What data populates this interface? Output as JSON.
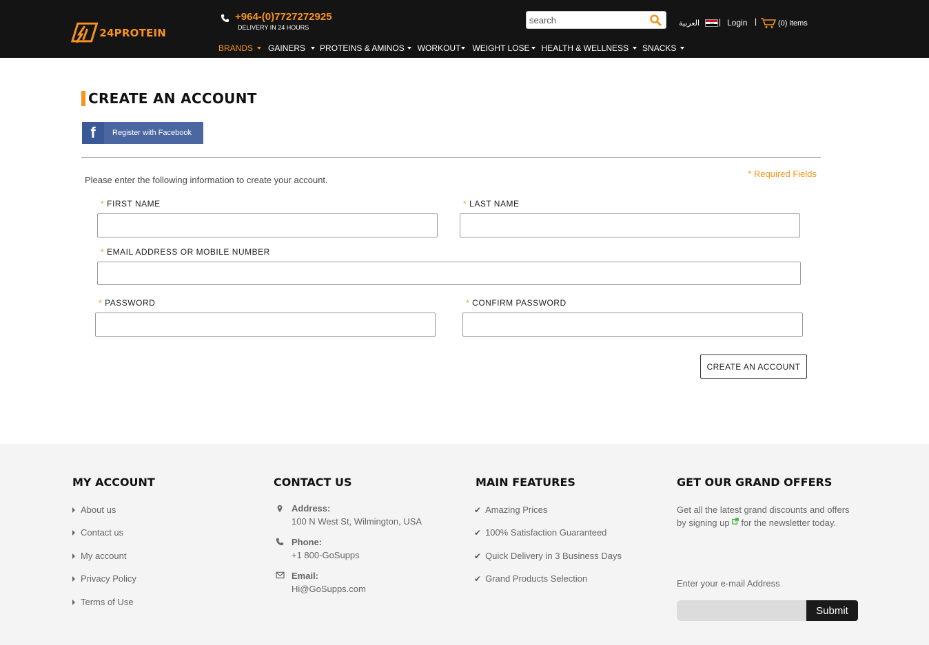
{
  "header": {
    "logo_text": "24PROTEIN",
    "phone": "+964-(0)7727272925",
    "delivery": "DELIVERY IN 24 HOURS",
    "search_placeholder": "search",
    "language": "العربية",
    "login": "Login",
    "cart": "(0) items",
    "separator": "|",
    "nav": [
      {
        "label": "BRANDS",
        "active": true
      },
      {
        "label": "GAINERS"
      },
      {
        "label": "PROTEINS & AMINOS"
      },
      {
        "label": "WORKOUT"
      },
      {
        "label": "WEIGHT LOSE"
      },
      {
        "label": "HEALTH & WELLNESS"
      },
      {
        "label": "SNACKS"
      }
    ]
  },
  "main": {
    "title": "CREATE AN ACCOUNT",
    "facebook_letter": "f",
    "facebook_label": "Register with Facebook",
    "intro": "Please enter the following information to create your account.",
    "required_note": "* Required Fields",
    "asterisk": "*",
    "fields": {
      "first_name": "FIRST NAME",
      "last_name": "LAST NAME",
      "email": "EMAIL ADDRESS OR MOBILE NUMBER",
      "password": "PASSWORD",
      "confirm_password": "CONFIRM PASSWORD"
    },
    "submit": "CREATE AN ACCOUNT"
  },
  "footer": {
    "my_account": {
      "heading": "MY ACCOUNT",
      "links": [
        "About us",
        "Contact us",
        "My account",
        "Privacy Policy",
        "Terms of Use"
      ]
    },
    "contact": {
      "heading": "CONTACT US",
      "address_title": "Address:",
      "address": "100 N West St, Wilmington, USA",
      "phone_title": "Phone:",
      "phone": "+1 800-GoSupps",
      "email_title": "Email:",
      "email": "Hi@GoSupps.com"
    },
    "features": {
      "heading": "MAIN FEATURES",
      "items": [
        "Amazing Prices",
        "100% Satisfaction Guaranteed",
        "Quick Delivery in 3 Business Days",
        "Grand Products Selection"
      ]
    },
    "offers": {
      "heading": "GET OUR GRAND OFFERS",
      "text_before": "Get all the latest grand discounts and offers by signing up",
      "text_after": "for the newsletter today.",
      "email_label": "Enter your e-mail Address",
      "submit": "Submit"
    }
  },
  "colors": {
    "accent": "#f7931e",
    "header_bg": "#141414",
    "facebook": "#4b67a1",
    "footer_bg": "#f4f4f4"
  },
  "icons": [
    "phone-icon",
    "search-icon",
    "iraq-flag-icon",
    "cart-icon",
    "facebook-icon",
    "map-pin-icon",
    "envelope-icon",
    "external-link-icon",
    "check-icon",
    "caret-right-icon"
  ]
}
